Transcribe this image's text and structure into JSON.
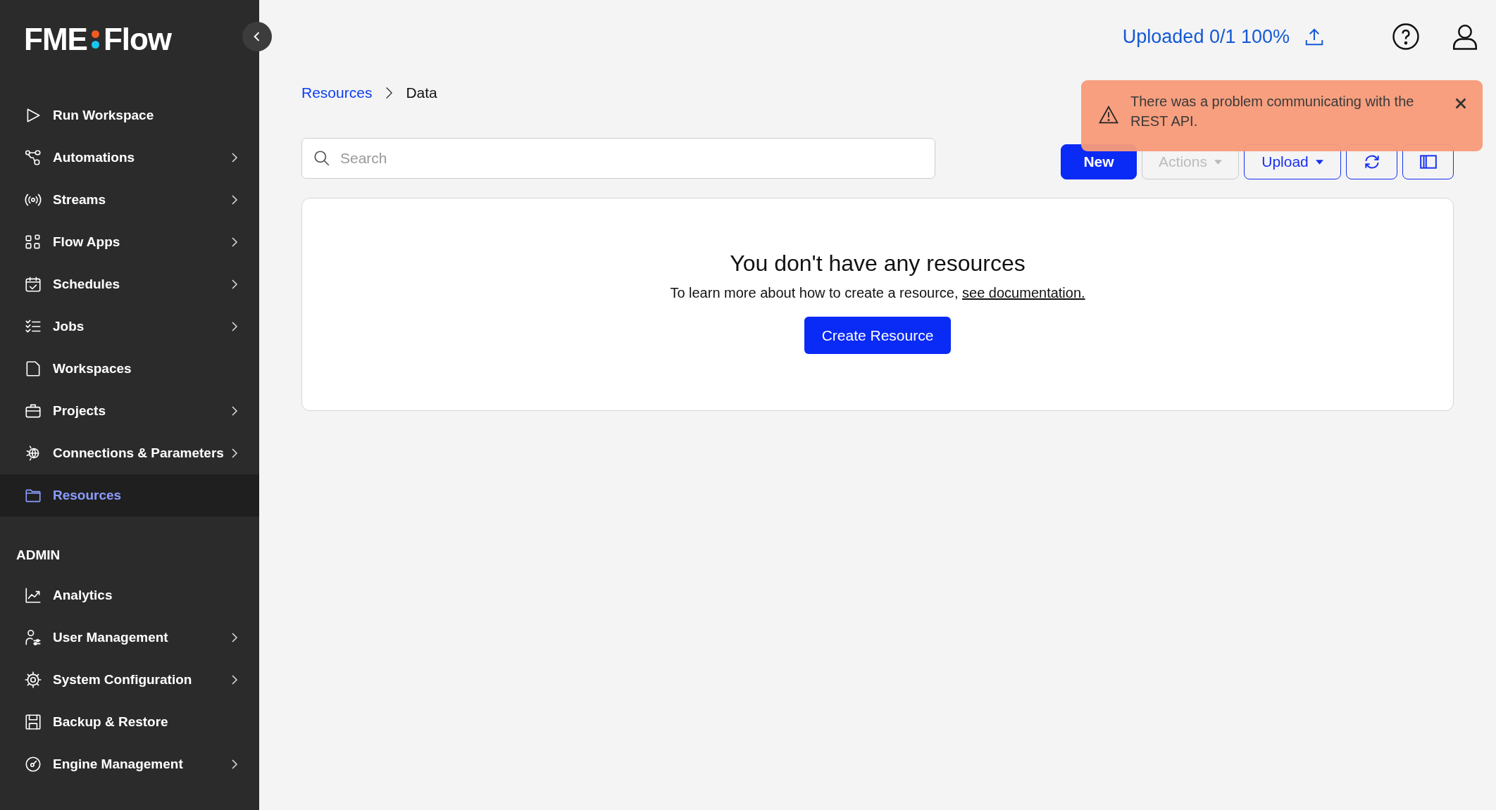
{
  "logo": {
    "left": "FME",
    "right": "Flow"
  },
  "sidebar": {
    "items": [
      {
        "label": "Run Workspace",
        "expandable": false,
        "selected": false
      },
      {
        "label": "Automations",
        "expandable": true,
        "selected": false
      },
      {
        "label": "Streams",
        "expandable": true,
        "selected": false
      },
      {
        "label": "Flow Apps",
        "expandable": true,
        "selected": false
      },
      {
        "label": "Schedules",
        "expandable": true,
        "selected": false
      },
      {
        "label": "Jobs",
        "expandable": true,
        "selected": false
      },
      {
        "label": "Workspaces",
        "expandable": false,
        "selected": false
      },
      {
        "label": "Projects",
        "expandable": true,
        "selected": false
      },
      {
        "label": "Connections & Parameters",
        "expandable": true,
        "selected": false
      },
      {
        "label": "Resources",
        "expandable": false,
        "selected": true
      }
    ],
    "admin_heading": "ADMIN",
    "admin_items": [
      {
        "label": "Analytics",
        "expandable": false,
        "selected": false
      },
      {
        "label": "User Management",
        "expandable": true,
        "selected": false
      },
      {
        "label": "System Configuration",
        "expandable": true,
        "selected": false
      },
      {
        "label": "Backup & Restore",
        "expandable": false,
        "selected": false
      },
      {
        "label": "Engine Management",
        "expandable": true,
        "selected": false
      }
    ]
  },
  "header": {
    "upload_status": "Uploaded 0/1 100%"
  },
  "breadcrumb": [
    {
      "label": "Resources",
      "link": true
    },
    {
      "label": "Data",
      "link": false
    }
  ],
  "search": {
    "placeholder": "Search"
  },
  "toolbar": [
    {
      "label": "New",
      "kind": "primary",
      "disabled": false
    },
    {
      "label": "Actions",
      "kind": "menu",
      "disabled": true
    },
    {
      "label": "Upload",
      "kind": "menu",
      "disabled": false
    },
    {
      "kind": "refresh",
      "disabled": false
    },
    {
      "kind": "columns",
      "disabled": false
    }
  ],
  "empty_state": {
    "title": "You don't have any resources",
    "text": "To learn more about how to create a resource,",
    "link": "see documentation.",
    "button": "Create Resource"
  },
  "toast": {
    "message": "There was a problem communicating with the REST API."
  }
}
